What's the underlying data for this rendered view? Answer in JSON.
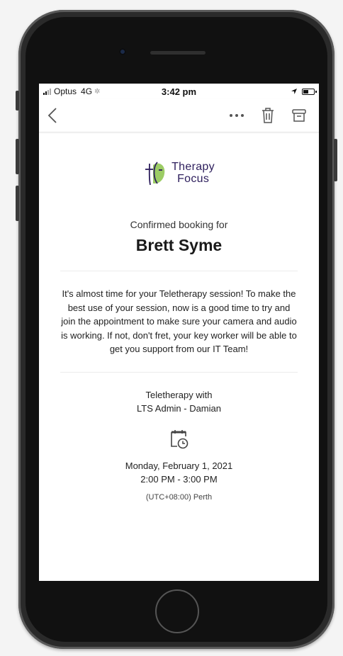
{
  "status_bar": {
    "carrier": "Optus",
    "network": "4G",
    "time": "3:42 pm",
    "battery_level": 0.55
  },
  "toolbar": {
    "back_icon": "chevron-left-icon",
    "more_icon": "more-horizontal-icon",
    "delete_icon": "trash-icon",
    "archive_icon": "archive-icon"
  },
  "logo": {
    "line1": "Therapy",
    "line2": "Focus",
    "colors": {
      "green": "#7cb342",
      "purple": "#2d1e5c"
    }
  },
  "email": {
    "subhead": "Confirmed booking for",
    "name": "Brett Syme",
    "message": "It's almost time for your Teletherapy session! To make the best use of your session, now is a good time to try and join the appointment to make sure your camera and audio is working. If not, don't fret, your key worker will be able to get you support from our IT Team!",
    "session_line1": "Teletherapy with",
    "session_line2": "LTS Admin - Damian",
    "calendar_icon": "calendar-clock-icon",
    "date": "Monday, February 1, 2021",
    "time_range": "2:00 PM - 3:00 PM",
    "timezone": "(UTC+08:00) Perth"
  }
}
